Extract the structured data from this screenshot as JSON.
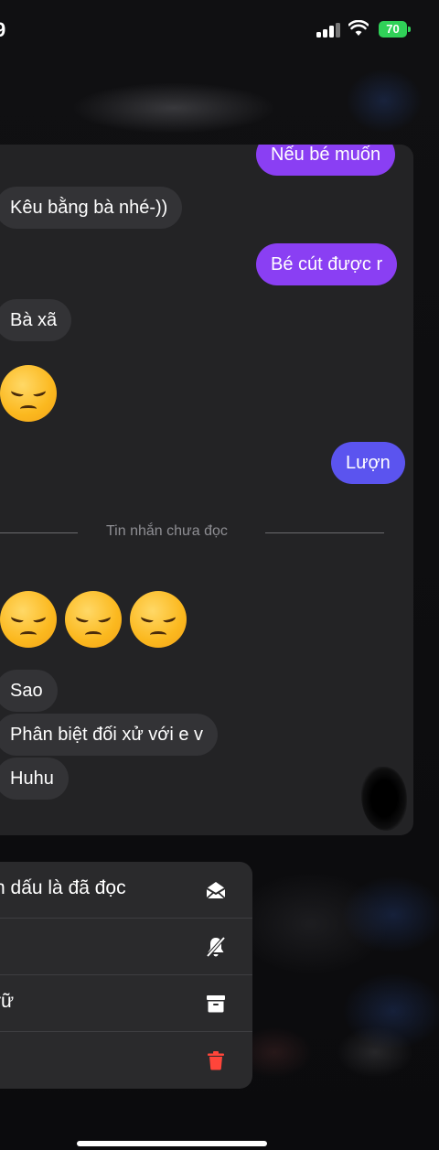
{
  "status_bar": {
    "time": "9",
    "battery": "70"
  },
  "messages": [
    {
      "text": "Nếu bé muốn",
      "direction": "outgoing"
    },
    {
      "text": "Kêu bằng bà nhé-))",
      "direction": "incoming"
    },
    {
      "text": "Bé cút được r",
      "direction": "outgoing"
    },
    {
      "text": "Bà xã",
      "direction": "incoming"
    },
    {
      "text": "Lượn",
      "direction": "outgoing"
    },
    {
      "text": "Sao",
      "direction": "incoming"
    },
    {
      "text": "Phân biệt đối xử với e v",
      "direction": "incoming"
    },
    {
      "text": "Huhu",
      "direction": "incoming"
    }
  ],
  "unread_divider": "Tin nhắn chưa đọc",
  "menu": {
    "items": [
      {
        "label": "n dấu là đã đọc",
        "icon": "envelope-open-icon"
      },
      {
        "label": "",
        "icon": "bell-slash-icon"
      },
      {
        "label": "rữ",
        "icon": "archive-icon"
      },
      {
        "label": "",
        "icon": "trash-icon"
      }
    ]
  },
  "colors": {
    "outgoing_purple": "#8a3ff3",
    "outgoing_blue": "#5b54ef",
    "incoming_bubble": "#333336",
    "delete_red": "#ff453a",
    "battery_green": "#30d158"
  }
}
